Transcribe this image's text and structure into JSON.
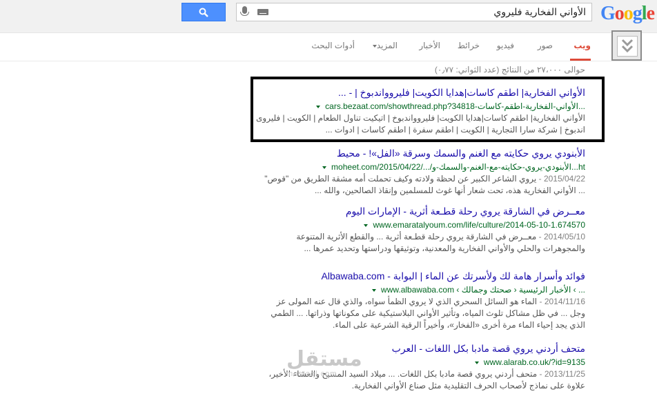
{
  "search": {
    "query": "الأواني الفخارية فليروي"
  },
  "tabs": {
    "web": "ويب",
    "images": "صور",
    "videos": "فيديو",
    "maps": "خرائط",
    "news": "الأخبار",
    "more": "المزيد",
    "tools": "أدوات البحث"
  },
  "stats": "حوالى ٢٧،٠٠٠ من النتائج (عدد الثواني: ٠٫٧٧)",
  "results": [
    {
      "title": "الأواني الفخارية| اطقم كاسات|هدايا الكويت| فليروواندبوخ | - ...",
      "url": "cars.bezaat.com/showthread.php?34818-الأواني-الفخارية-اطقم-كاسات...",
      "line1": "الأواني الفخارية| اطقم كاسات|هدايا الكويت| فليروواندبوخ | اتيكيت تناول الطعام | الكويت | فليروى",
      "line2": "اندبوخ | شركة سارا التجارية | الكويت | اطقم سفرة | اطقم كاسات | ادوات ..."
    },
    {
      "title": "الأبنودي يروي حكايته مع الغنم والسمك وسرقة «الفل»! - محيط",
      "url": "moheet.com/2015/04/22/.../الأبنودي-يروي-حكايته-مع-الغنم-والسمك-و...ht",
      "date": "2015/04/22 -",
      "line1": "يروي الشاعر الكبير عن لحظة ولادته وكيف تحملت أمه مشقة الطريق من \"قوص\"",
      "line2": "... الأواني الفخارية هذه، تحت شعار أنها غوث للمسلمين وإنقاذ الصالحين، والله ..."
    },
    {
      "title": "معــرض في الشارقة يروي رحلة قطـعة أثرية - الإمارات اليوم",
      "url": "www.emaratalyoum.com/life/culture/2014-05-10-1.674570",
      "date": "2014/05/10 -",
      "line1": "معــرض في الشارقة يروي رحلة قطـعة أثرية ... والقطع الأثرية المتنوعة",
      "line2": "والمجوهرات والحلي والأواني الفخارية والمعدنية، وتوثيقها ودراستها وتحديد عمرها ..."
    },
    {
      "title": "فوائد وأسرار هامة لك ولأسرتك عن الماء | البوابة - Albawaba.com",
      "url": "www.albawaba.com ‹ الأخبار الرئيسية ‹ صحتك وجمالك ‹ ...",
      "date": "2014/11/16 -",
      "line1": "الماء هو السائل السحري الذي لا يروي الظمأ سواه، والذي قال عنه المولى عز",
      "line2": "وجل ... في ظل مشاكل تلوث المياه، وتأثير الأواني البلاستيكية على مكوناتها وذراتها. ... الطمي",
      "line3": "الذي يجد إحياء الماء مرة أخرى «الفخار»، وأخيراً الرقية الشرعية على الماء."
    },
    {
      "title": "متحف أردني يروي قصة مادبا بكل اللغات - العرب",
      "url": "www.alarab.co.uk/?id=9135",
      "date": "2013/11/25 -",
      "line1": "متحف أردني يروي قصة مادبا بكل اللغات. ... ميلاد السيد المسيح والعشاء الأخير،",
      "line2": "علاوة على نماذج لأصحاب الحرف التقليدية مثل صناع الأواني الفخارية."
    }
  ],
  "watermark": {
    "ar": "مستقل",
    "en": "mostaql.com"
  }
}
